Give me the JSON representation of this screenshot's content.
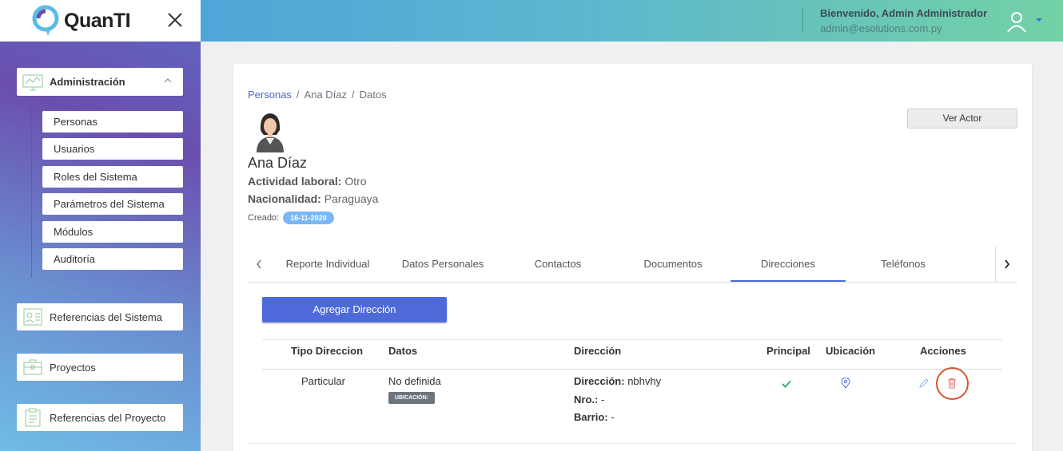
{
  "app": {
    "logo_text": "QuanTI"
  },
  "header": {
    "welcome": "Bienvenido, Admin Administrador",
    "email": "admin@esolutions.com.py"
  },
  "sidebar": {
    "admin_label": "Administración",
    "sub_items": [
      {
        "label": "Personas"
      },
      {
        "label": "Usuarios"
      },
      {
        "label": "Roles del Sistema"
      },
      {
        "label": "Parámetros del Sistema"
      },
      {
        "label": "Módulos"
      },
      {
        "label": "Auditoría"
      }
    ],
    "ref_sistema_label": "Referencias del Sistema",
    "proyectos_label": "Proyectos",
    "ref_proyecto_label": "Referencias del Proyecto"
  },
  "breadcrumb": {
    "root": "Personas",
    "person": "Ana Díaz",
    "current": "Datos"
  },
  "person": {
    "name": "Ana Díaz",
    "actividad_label": "Actividad laboral:",
    "actividad_value": "Otro",
    "nacionalidad_label": "Nacionalidad:",
    "nacionalidad_value": "Paraguaya",
    "creado_label": "Creado:",
    "creado_value": "16-11-2020"
  },
  "ver_actor_label": "Ver Actor",
  "tabs": [
    {
      "label": "Reporte Individual"
    },
    {
      "label": "Datos Personales"
    },
    {
      "label": "Contactos"
    },
    {
      "label": "Documentos"
    },
    {
      "label": "Direcciones",
      "active": true
    },
    {
      "label": "Teléfonos"
    }
  ],
  "add_button_label": "Agregar Dirección",
  "table": {
    "headers": {
      "tipo": "Tipo Direccion",
      "datos": "Datos",
      "direccion": "Dirección",
      "principal": "Principal",
      "ubicacion": "Ubicación",
      "acciones": "Acciones"
    },
    "rows": [
      {
        "tipo": "Particular",
        "datos": "No definida",
        "badge": "UBICACIÓN:",
        "dir_label": "Dirección:",
        "dir_value": "nbhvhy",
        "nro_label": "Nro.:",
        "nro_value": "-",
        "barrio_label": "Barrio:",
        "barrio_value": "-"
      }
    ]
  },
  "colors": {
    "accent": "#4e6ad9",
    "success": "#3cb371",
    "danger": "#e06666",
    "highlight": "#d9542f"
  },
  "icons": [
    "close-icon",
    "administracion-icon",
    "chevron-up-icon",
    "referencias-icon",
    "proyectos-icon",
    "clipboard-icon",
    "user-icon",
    "chevron-left-icon",
    "chevron-right-icon",
    "check-icon",
    "map-pin-icon",
    "edit-icon",
    "trash-icon"
  ]
}
